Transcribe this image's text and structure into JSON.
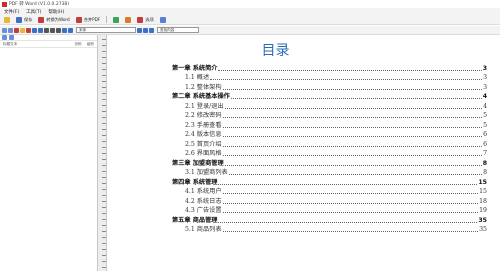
{
  "window": {
    "title": "PDF 转 Word (V1.0.0.2738)"
  },
  "menu": [
    "文件(F)",
    "工具(T)",
    "帮助(H)"
  ],
  "toolbar": {
    "save_label": "保存",
    "convert_label": "转换为Word",
    "combine_label": "合并PDF",
    "settings_label": "选项"
  },
  "toolbar2": {
    "font_combo": "宋体",
    "search_combo": "查找内容"
  },
  "sidebar": {
    "col_title": "标题文本",
    "col_page": "页码",
    "col_level": "级别"
  },
  "document": {
    "title": "目录",
    "toc": [
      {
        "level": "chapter",
        "text": "第一章  系统简介",
        "page": "3"
      },
      {
        "level": "section",
        "text": "1.1 概述",
        "page": "3"
      },
      {
        "level": "section",
        "text": "1.2 整体架构",
        "page": "3"
      },
      {
        "level": "chapter",
        "text": "第二章  系统基本操作",
        "page": "4"
      },
      {
        "level": "section",
        "text": "2.1 登录/退出",
        "page": "4"
      },
      {
        "level": "section",
        "text": "2.2 修改密码",
        "page": "5"
      },
      {
        "level": "section",
        "text": "2.3 手册查看",
        "page": "5"
      },
      {
        "level": "section",
        "text": "2.4 版本信息",
        "page": "6"
      },
      {
        "level": "section",
        "text": "2.5 首页介绍",
        "page": "6"
      },
      {
        "level": "section",
        "text": "2.6 界面风格",
        "page": "7"
      },
      {
        "level": "chapter",
        "text": "第三章  加盟商管理",
        "page": "8"
      },
      {
        "level": "section",
        "text": "3.1 加盟商列表",
        "page": "8"
      },
      {
        "level": "chapter",
        "text": "第四章  系统管理",
        "page": "15"
      },
      {
        "level": "section",
        "text": "4.1 系统用户",
        "page": "15"
      },
      {
        "level": "section",
        "text": "4.2 系统日志",
        "page": "18"
      },
      {
        "level": "section",
        "text": "4.3 广告设置",
        "page": "19"
      },
      {
        "level": "chapter",
        "text": "第五章  商品管理",
        "page": "35"
      },
      {
        "level": "section",
        "text": "5.1 商品列表",
        "page": "35"
      }
    ]
  },
  "colors": {
    "title_blue": "#2b6cb8",
    "app_red": "#d12a2a"
  },
  "icons": [
    "app-icon",
    "open-icon",
    "save-icon",
    "convert-icon",
    "merge-icon",
    "settings-icon"
  ]
}
